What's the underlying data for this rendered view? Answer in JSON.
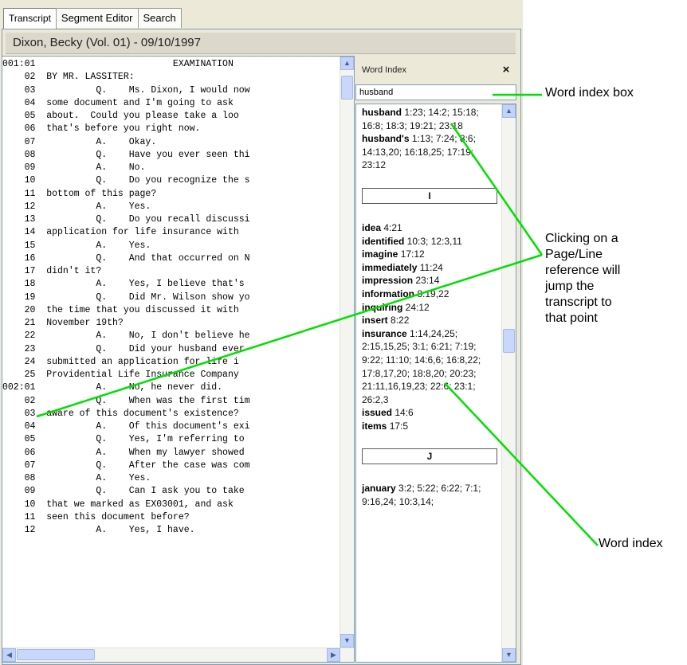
{
  "tabs": [
    "Transcript",
    "Segment Editor",
    "Search"
  ],
  "doc_title": "Dixon, Becky (Vol. 01) - 09/10/1997",
  "transcript_lines": [
    "001:01                         EXAMINATION",
    "    02  BY MR. LASSITER:",
    "    03           Q.    Ms. Dixon, I would now",
    "    04  some document and I'm going to ask",
    "    05  about.  Could you please take a loo",
    "    06  that's before you right now.",
    "    07           A.    Okay.",
    "    08           Q.    Have you ever seen thi",
    "    09           A.    No.",
    "    10           Q.    Do you recognize the s",
    "    11  bottom of this page?",
    "    12           A.    Yes.",
    "    13           Q.    Do you recall discussi",
    "    14  application for life insurance with",
    "    15           A.    Yes.",
    "    16           Q.    And that occurred on N",
    "    17  didn't it?",
    "    18           A.    Yes, I believe that's",
    "    19           Q.    Did Mr. Wilson show yo",
    "    20  the time that you discussed it with",
    "    21  November 19th?",
    "    22           A.    No, I don't believe he",
    "    23           Q.    Did your husband ever",
    "    24  submitted an application for life i",
    "    25  Providential Life Insurance Company",
    "002:01           A.    No, he never did.",
    "    02           Q.    When was the first tim",
    "    03  aware of this document's existence?",
    "    04           A.    Of this document's exi",
    "    05           Q.    Yes, I'm referring to",
    "    06           A.    When my lawyer showed",
    "    07           Q.    After the case was com",
    "    08           A.    Yes.",
    "    09           Q.    Can I ask you to take",
    "    10  that we marked as EX03001, and ask",
    "    11  seen this document before?",
    "    12           A.    Yes, I have."
  ],
  "word_index": {
    "title": "Word Index",
    "close": "×",
    "search_value": "husband",
    "h_entries": [
      {
        "word": "husband",
        "refs": "1:23; 14:2; 15:18; 16:8; 18:3; 19:21; 23:18"
      },
      {
        "word": "husband's",
        "refs": "1:13; 7:24; 8:6; 14:13,20; 16:18,25; 17:19; 23:12"
      }
    ],
    "letter_i": "I",
    "i_entries": [
      {
        "word": "idea",
        "refs": "4:21"
      },
      {
        "word": "identified",
        "refs": "10:3; 12:3,11"
      },
      {
        "word": "imagine",
        "refs": "17:12"
      },
      {
        "word": "immediately",
        "refs": "11:24"
      },
      {
        "word": "impression",
        "refs": "23:14"
      },
      {
        "word": "information",
        "refs": "8:19,22"
      },
      {
        "word": "inquiring",
        "refs": "24:12"
      },
      {
        "word": "insert",
        "refs": "8:22"
      },
      {
        "word": "insurance",
        "refs": "1:14,24,25; 2:15,15,25; 3:1; 6:21; 7:19; 9:22; 11:10; 14:6,6; 16:8,22; 17:8,17,20; 18:8,20; 20:23; 21:11,16,19,23; 22:6; 23:1; 26:2,3"
      },
      {
        "word": "issued",
        "refs": "14:6"
      },
      {
        "word": "items",
        "refs": "17:5"
      }
    ],
    "letter_j": "J",
    "j_entries": [
      {
        "word": "january",
        "refs": "3:2; 5:22; 6:22; 7:1; 9:16,24; 10:3,14;"
      }
    ]
  },
  "callouts": {
    "word_index_box": "Word index box",
    "page_line": [
      "Clicking on a",
      "Page/Line",
      "reference will",
      "jump the",
      "transcript to",
      "that point"
    ],
    "word_index": "Word index"
  },
  "colors": {
    "callout_line": "#00e000",
    "accent": "#7f9db9"
  }
}
